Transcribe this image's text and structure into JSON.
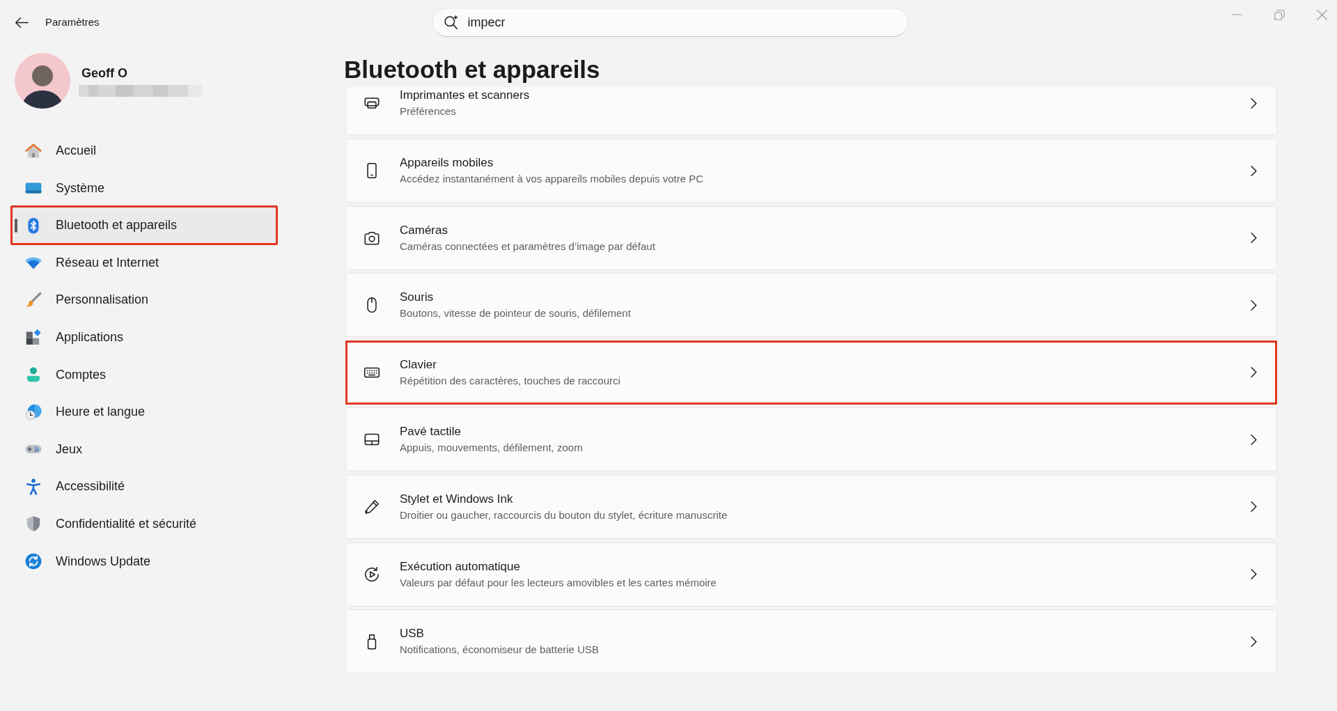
{
  "window": {
    "title": "Paramètres"
  },
  "search": {
    "value": "impecr"
  },
  "profile": {
    "name": "Geoff O",
    "email_redacted": true
  },
  "sidebar": {
    "items": [
      {
        "label": "Accueil",
        "selected": false,
        "highlighted": false
      },
      {
        "label": "Système",
        "selected": false,
        "highlighted": false
      },
      {
        "label": "Bluetooth et appareils",
        "selected": true,
        "highlighted": true
      },
      {
        "label": "Réseau et Internet",
        "selected": false,
        "highlighted": false
      },
      {
        "label": "Personnalisation",
        "selected": false,
        "highlighted": false
      },
      {
        "label": "Applications",
        "selected": false,
        "highlighted": false
      },
      {
        "label": "Comptes",
        "selected": false,
        "highlighted": false
      },
      {
        "label": "Heure et langue",
        "selected": false,
        "highlighted": false
      },
      {
        "label": "Jeux",
        "selected": false,
        "highlighted": false
      },
      {
        "label": "Accessibilité",
        "selected": false,
        "highlighted": false
      },
      {
        "label": "Confidentialité et sécurité",
        "selected": false,
        "highlighted": false
      },
      {
        "label": "Windows Update",
        "selected": false,
        "highlighted": false
      }
    ]
  },
  "page": {
    "title": "Bluetooth et appareils"
  },
  "cards": [
    {
      "title": "Imprimantes et scanners",
      "subtitle": "Préférences",
      "highlighted": false
    },
    {
      "title": "Appareils mobiles",
      "subtitle": "Accédez instantanément à vos appareils mobiles depuis votre PC",
      "highlighted": false
    },
    {
      "title": "Caméras",
      "subtitle": "Caméras connectées et paramètres d’image par défaut",
      "highlighted": false
    },
    {
      "title": "Souris",
      "subtitle": "Boutons, vitesse de pointeur de souris, défilement",
      "highlighted": false
    },
    {
      "title": "Clavier",
      "subtitle": "Répétition des caractères, touches de raccourci",
      "highlighted": true
    },
    {
      "title": "Pavé tactile",
      "subtitle": "Appuis, mouvements, défilement, zoom",
      "highlighted": false
    },
    {
      "title": "Stylet et Windows Ink",
      "subtitle": "Droitier ou gaucher, raccourcis du bouton du stylet, écriture manuscrite",
      "highlighted": false
    },
    {
      "title": "Exécution automatique",
      "subtitle": "Valeurs par défaut pour les lecteurs amovibles et les cartes mémoire",
      "highlighted": false
    },
    {
      "title": "USB",
      "subtitle": "Notifications, économiseur de batterie USB",
      "highlighted": false
    }
  ]
}
